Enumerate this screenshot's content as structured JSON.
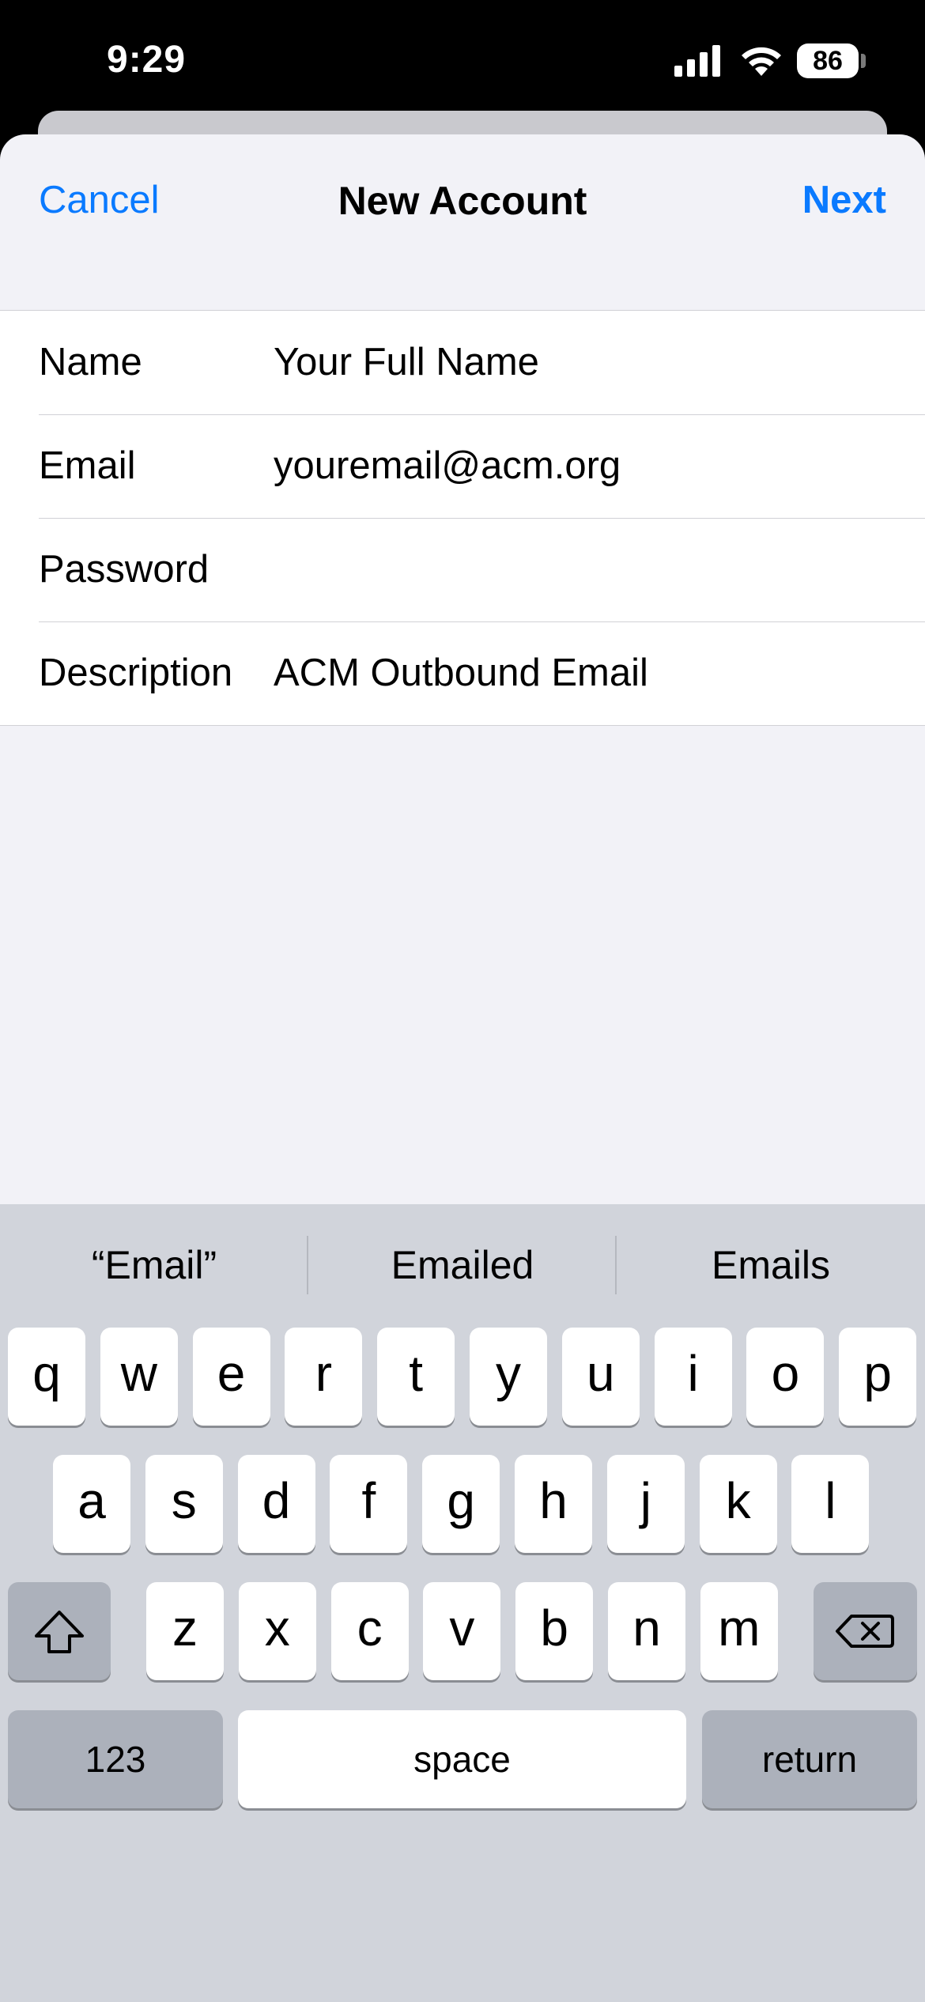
{
  "status_bar": {
    "time": "9:29",
    "battery": "86"
  },
  "nav": {
    "cancel_label": "Cancel",
    "title": "New Account",
    "next_label": "Next"
  },
  "form": {
    "rows": [
      {
        "label": "Name",
        "value": "Your Full Name"
      },
      {
        "label": "Email",
        "value": "youremail@acm.org"
      },
      {
        "label": "Password",
        "value": ""
      },
      {
        "label": "Description",
        "value": "ACM Outbound Email"
      }
    ]
  },
  "keyboard": {
    "suggestions": [
      "“Email”",
      "Emailed",
      "Emails"
    ],
    "row1": [
      "q",
      "w",
      "e",
      "r",
      "t",
      "y",
      "u",
      "i",
      "o",
      "p"
    ],
    "row2": [
      "a",
      "s",
      "d",
      "f",
      "g",
      "h",
      "j",
      "k",
      "l"
    ],
    "row3": [
      "z",
      "x",
      "c",
      "v",
      "b",
      "n",
      "m"
    ],
    "numbers_label": "123",
    "space_label": "space",
    "return_label": "return",
    "icons": {
      "shift": "shift-icon",
      "delete": "delete-icon",
      "emoji": "emoji-icon",
      "mic": "microphone-icon"
    }
  },
  "colors": {
    "accent": "#0a7aff",
    "background": "#f2f2f7",
    "keyboard": "#d1d4db"
  }
}
